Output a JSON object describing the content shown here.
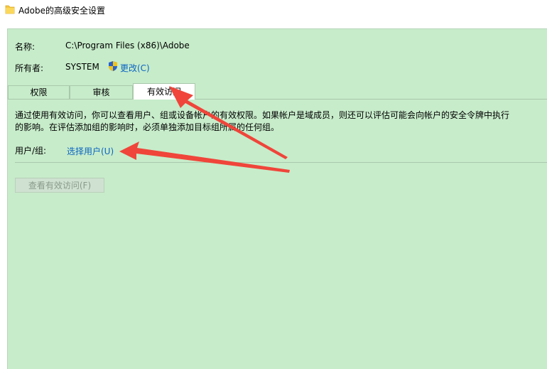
{
  "window": {
    "title": "Adobe的高级安全设置",
    "folder_icon": "folder-icon"
  },
  "info": {
    "name_label": "名称:",
    "name_value": "C:\\Program Files (x86)\\Adobe",
    "owner_label": "所有者:",
    "owner_value": "SYSTEM",
    "change_link": "更改(C)",
    "shield_icon": "uac-shield-icon"
  },
  "tabs": [
    {
      "label": "权限",
      "active": false
    },
    {
      "label": "审核",
      "active": false
    },
    {
      "label": "有效访问",
      "active": true
    }
  ],
  "effective_access": {
    "description_line1": "通过使用有效访问，你可以查看用户、组或设备帐户的有效权限。如果帐户是域成员，则还可以评估可能会向帐户的安全令牌中执行",
    "description_line2": "的影响。在评估添加组的影响时，必须单独添加目标组所属的任何组。",
    "user_group_label": "用户/组:",
    "select_user_link": "选择用户(U)",
    "view_button": "查看有效访问(F)"
  },
  "colors": {
    "background": "#c7ecca",
    "link": "#0a64c2",
    "annotation_arrow": "#f0453a"
  }
}
